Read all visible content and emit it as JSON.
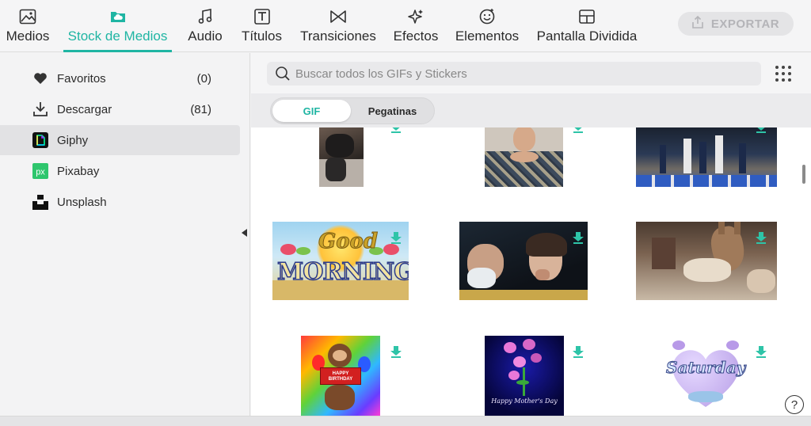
{
  "toolbar": {
    "tabs": [
      {
        "label": "Medios",
        "icon": "image-icon"
      },
      {
        "label": "Stock de Medios",
        "icon": "cloud-folder-icon",
        "active": true
      },
      {
        "label": "Audio",
        "icon": "music-note-icon"
      },
      {
        "label": "Títulos",
        "icon": "text-t-icon"
      },
      {
        "label": "Transiciones",
        "icon": "bowtie-icon"
      },
      {
        "label": "Efectos",
        "icon": "sparkle-icon"
      },
      {
        "label": "Elementos",
        "icon": "smiley-sticker-icon"
      },
      {
        "label": "Pantalla Dividida",
        "icon": "split-screen-icon"
      }
    ],
    "export_label": "EXPORTAR"
  },
  "sidebar": {
    "items": [
      {
        "label": "Favoritos",
        "count": "(0)",
        "icon": "heart-icon"
      },
      {
        "label": "Descargar",
        "count": "(81)",
        "icon": "download-icon"
      },
      {
        "label": "Giphy",
        "count": "",
        "icon": "giphy-logo-icon",
        "selected": true
      },
      {
        "label": "Pixabay",
        "count": "",
        "icon": "pixabay-logo-icon"
      },
      {
        "label": "Unsplash",
        "count": "",
        "icon": "unsplash-logo-icon"
      }
    ]
  },
  "search": {
    "placeholder": "Buscar todos los GIFs y Stickers"
  },
  "filter": {
    "gif_label": "GIF",
    "stickers_label": "Pegatinas",
    "active": "GIF"
  },
  "gifs": {
    "good_morning_line1": "Good",
    "good_morning_line2": "MORNING",
    "birthday_banner": "HAPPY BIRTHDAY",
    "mothers_day_text": "Happy Mother's Day",
    "saturday_text": "Saturday"
  },
  "help_label": "?",
  "colors": {
    "accent": "#1fb5a3",
    "download": "#2ec4a8"
  }
}
